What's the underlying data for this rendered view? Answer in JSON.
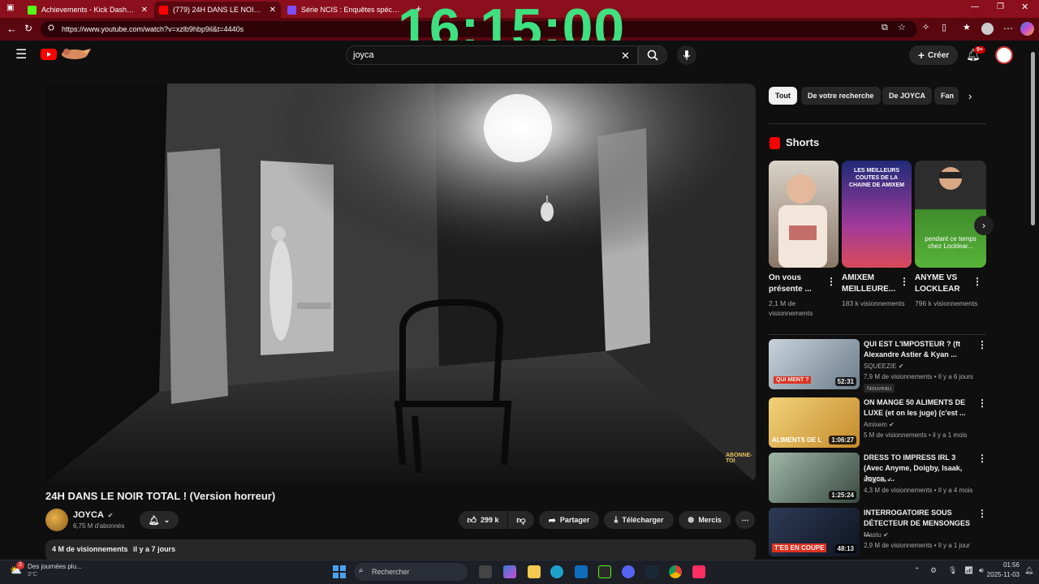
{
  "browser": {
    "tabs": [
      {
        "title": "Achievements - Kick Dashboard",
        "color": "#53fc18"
      },
      {
        "title": "(779) 24H DANS LE NOIR TOTAL !",
        "color": "#ff0000"
      },
      {
        "title": "Série NCIS : Enquêtes spéciales s",
        "color": "#7b4dff"
      }
    ],
    "url": "https://www.youtube.com/watch?v=xzlb9hbp9il&t=4440s"
  },
  "overlay_clock": "16:15:00",
  "youtube": {
    "search_value": "joyca",
    "create_label": "Créer",
    "notif_count": "9+",
    "video": {
      "title": "24H DANS LE NOIR TOTAL ! (Version horreur)",
      "channel": "JOYCA",
      "subscribers": "6,75 M d'abonnés",
      "likes": "299 k",
      "share_label": "Partager",
      "download_label": "Télécharger",
      "thanks_label": "Mercis",
      "views": "4 M de visionnements",
      "age": "il y a 7 jours",
      "watermark": "ABONNE-TOI"
    },
    "chips": [
      "Tout",
      "De votre recherche",
      "De JOYCA",
      "Fan"
    ],
    "shorts_title": "Shorts",
    "shorts": [
      {
        "title": "On vous présente ...",
        "views": "2,1 M de visionnements"
      },
      {
        "title": "AMIXEM MEILLEURE...",
        "views": "183 k visionnements",
        "overlay": "LES MEILLEURS COUTES DE LA CHAINE DE AMIXEM"
      },
      {
        "title": "ANYME VS LOCKLEAR",
        "views": "796 k visionnements",
        "overlay": "pendant ce temps chez Locklear..."
      }
    ],
    "related": [
      {
        "title": "QUI EST L'IMPOSTEUR ? (ft Alexandre Astier & Kyan ...",
        "channel": "SQUEEZIE",
        "views": "7,9 M de visionnements",
        "age": "Il y a 6 jours",
        "duration": "52:31",
        "badge": "Nouveau",
        "thumb_text": "QUI MENT ?"
      },
      {
        "title": "ON MANGE 50 ALIMENTS DE LUXE (et on les juge) (c'est ...",
        "channel": "Amixem",
        "views": "5 M de visionnements",
        "age": "il y a 1 mois",
        "duration": "1:06:27",
        "thumb_text": "ALIMENTS DE L"
      },
      {
        "title": "DRESS TO IMPRESS IRL 3 (Avec Anyme, Doigby, Isaak, Joyca, ...",
        "channel": "Maghla",
        "views": "4,3 M de visionnements",
        "age": "Il y a 4 mois",
        "duration": "1:25:24"
      },
      {
        "title": "INTERROGATOIRE SOUS DÉTECTEUR DE MENSONGES ...",
        "channel": "Mastu",
        "views": "2,9 M de visionnements",
        "age": "Il y a 1 jour",
        "duration": "48:13",
        "thumb_text": "T'ES EN COUPE"
      }
    ]
  },
  "taskbar": {
    "weather_title": "Des journées plu...",
    "weather_temp": "3°C",
    "weather_badge": "3",
    "search_placeholder": "Rechercher",
    "time": "01:56",
    "date": "2025-11-03"
  }
}
